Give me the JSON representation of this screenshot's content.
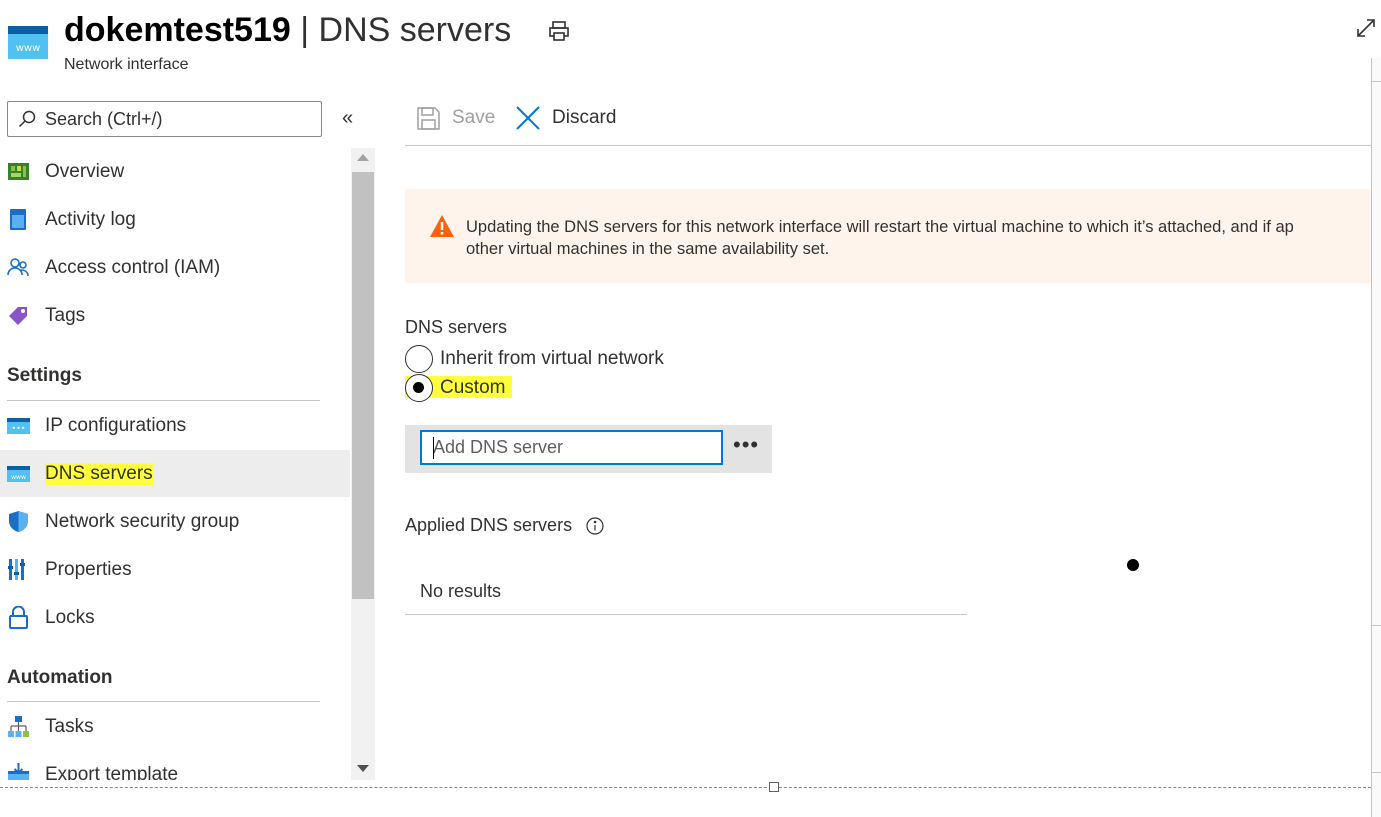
{
  "header": {
    "resource_name": "dokemtest519",
    "separator": "|",
    "page_name": "DNS servers",
    "subtitle": "Network interface"
  },
  "search": {
    "placeholder": "Search (Ctrl+/)"
  },
  "collapse_glyph": "«",
  "nav": {
    "items_top": [
      {
        "label": "Overview",
        "icon": "overview-icon"
      },
      {
        "label": "Activity log",
        "icon": "activity-log-icon"
      },
      {
        "label": "Access control (IAM)",
        "icon": "iam-icon"
      },
      {
        "label": "Tags",
        "icon": "tag-icon"
      }
    ],
    "settings_heading": "Settings",
    "settings_items": [
      {
        "label": "IP configurations",
        "icon": "ip-configurations-icon"
      },
      {
        "label": "DNS servers",
        "icon": "dns-servers-icon",
        "selected": true
      },
      {
        "label": "Network security group",
        "icon": "shield-icon"
      },
      {
        "label": "Properties",
        "icon": "properties-icon"
      },
      {
        "label": "Locks",
        "icon": "lock-icon"
      }
    ],
    "automation_heading": "Automation",
    "automation_items": [
      {
        "label": "Tasks",
        "icon": "tasks-icon"
      },
      {
        "label": "Export template",
        "icon": "export-template-icon"
      }
    ]
  },
  "toolbar": {
    "save_label": "Save",
    "discard_label": "Discard"
  },
  "warning": {
    "text": "Updating the DNS servers for this network interface will restart the virtual machine to which it’s attached, and if ap",
    "text_line2": "other virtual machines in the same availability set."
  },
  "dns": {
    "section_label": "DNS servers",
    "options": [
      "Inherit from virtual network",
      "Custom"
    ],
    "selected": "Custom",
    "input_placeholder": "Add DNS server",
    "more_glyph": "•••"
  },
  "applied": {
    "label": "Applied DNS servers",
    "empty_text": "No results"
  },
  "colors": {
    "accent": "#0078d4",
    "highlight": "#ffff3d",
    "warning_bg": "#fff4ec",
    "warning_icon": "#f7630c",
    "selected_bg": "#ededed"
  }
}
